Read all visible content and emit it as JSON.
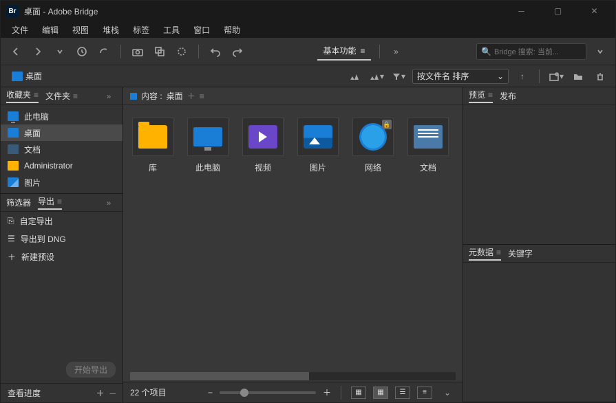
{
  "app": {
    "badge": "Br",
    "title": "桌面 - Adobe Bridge"
  },
  "menu": [
    "文件",
    "编辑",
    "视图",
    "堆栈",
    "标签",
    "工具",
    "窗口",
    "帮助"
  ],
  "toolbar": {
    "workspace_label": "基本功能",
    "search_placeholder": "Bridge 搜索: 当前..."
  },
  "pathbar": {
    "crumb": "桌面",
    "sort_label": "按文件名 排序"
  },
  "left": {
    "tabs": {
      "favorites": "收藏夹",
      "folders": "文件夹"
    },
    "favorites": [
      {
        "label": "此电脑",
        "icon": "monitor"
      },
      {
        "label": "桌面",
        "icon": "folder-b",
        "selected": true
      },
      {
        "label": "文档",
        "icon": "folder-d"
      },
      {
        "label": "Administrator",
        "icon": "folder-y"
      },
      {
        "label": "图片",
        "icon": "image"
      }
    ],
    "lower_tabs": {
      "filter": "筛选器",
      "export": "导出"
    },
    "export_items": [
      "自定导出",
      "导出到 DNG",
      "新建预设"
    ],
    "start_export": "开始导出",
    "view_progress": "查看进度"
  },
  "content": {
    "header_prefix": "内容 :",
    "header_loc": "桌面",
    "items": [
      {
        "label": "库",
        "icon": "folder"
      },
      {
        "label": "此电脑",
        "icon": "monitor"
      },
      {
        "label": "视频",
        "icon": "video"
      },
      {
        "label": "图片",
        "icon": "image"
      },
      {
        "label": "网络",
        "icon": "network",
        "locked": true
      },
      {
        "label": "文档",
        "icon": "doc"
      }
    ]
  },
  "right": {
    "tabs_top": {
      "preview": "预览",
      "publish": "发布"
    },
    "tabs_bottom": {
      "metadata": "元数据",
      "keywords": "关键字"
    }
  },
  "status": {
    "count": "22 个项目"
  }
}
